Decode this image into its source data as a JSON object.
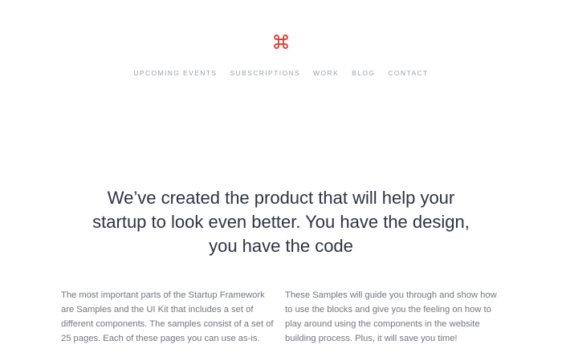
{
  "brand": {
    "logo_icon": "command-key-icon",
    "accent_color": "#e0453b"
  },
  "nav": {
    "items": [
      {
        "label": "UPCOMING EVENTS"
      },
      {
        "label": "SUBSCRIPTIONS"
      },
      {
        "label": "WORK"
      },
      {
        "label": "BLOG"
      },
      {
        "label": "CONTACT"
      }
    ]
  },
  "hero": {
    "headline": "We’ve created the product that will help your startup to look even better. You have the design, you have the code"
  },
  "content": {
    "left_paragraph": "The most important parts of the Startup Framework are Samples and the UI Kit that includes a set of different components. The samples consist of a set of 25 pages. Each of these pages you can use as-is.",
    "right_paragraph": "These Samples will guide you through and show how to use the blocks and give you the feeling on how to play around using the components in the website building process. Plus, it will save you time!"
  }
}
